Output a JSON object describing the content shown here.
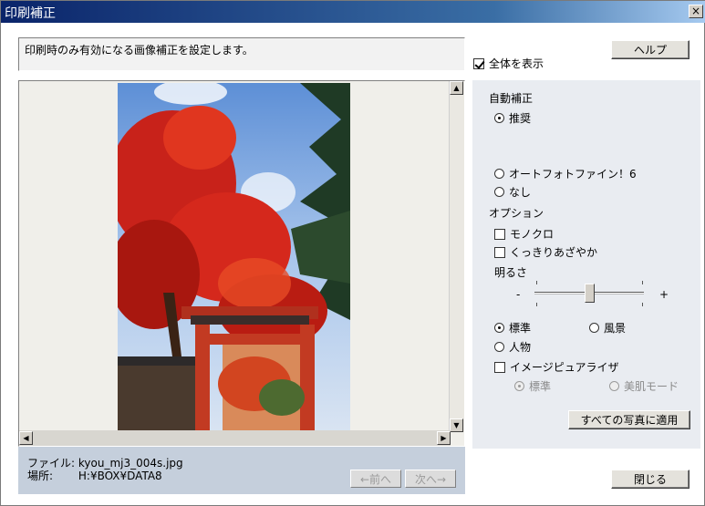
{
  "window": {
    "title": "印刷補正",
    "close_label": "×"
  },
  "description": "印刷時のみ有効になる画像補正を設定します。",
  "show_all": {
    "label": "全体を表示",
    "checked": true
  },
  "help_button": "ヘルプ",
  "file_info": {
    "file_label": "ファイル:",
    "file_value": "kyou_mj3_004s.jpg",
    "location_label": "場所:",
    "location_value": "H:¥BOX¥DATA8"
  },
  "nav": {
    "prev": "←前へ",
    "next": "次へ→"
  },
  "panel": {
    "auto_correct_label": "自動補正",
    "auto_options": [
      {
        "label": "推奨",
        "selected": true
      },
      {
        "label": "オートフォトファイン！6",
        "selected": false
      },
      {
        "label": "なし",
        "selected": false
      }
    ],
    "options_label": "オプション",
    "checkboxes": [
      {
        "label": "モノクロ",
        "checked": false
      },
      {
        "label": "くっきりあざやか",
        "checked": false
      }
    ],
    "brightness_label": "明るさ",
    "brightness_minus": "-",
    "brightness_plus": "+",
    "brightness_level": 0.5,
    "scene_options": [
      {
        "label": "標準",
        "selected": true
      },
      {
        "label": "風景",
        "selected": false
      },
      {
        "label": "人物",
        "selected": false
      }
    ],
    "image_equalizer": {
      "label": "イメージピュアライザ",
      "checked": false
    },
    "equalizer_options": [
      {
        "label": "標準",
        "selected": true,
        "disabled": true
      },
      {
        "label": "美肌モード",
        "selected": false,
        "disabled": true
      }
    ],
    "apply_all": "すべての写真に適用"
  },
  "close_button": "閉じる"
}
